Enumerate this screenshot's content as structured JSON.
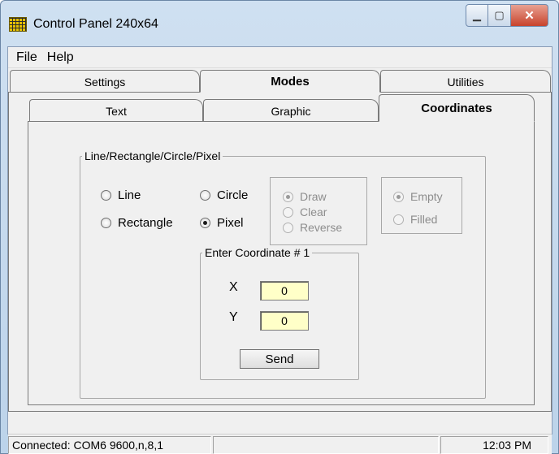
{
  "window": {
    "title": "Control Panel 240x64",
    "icon": "lcd-grid-icon"
  },
  "menu": [
    "File",
    "Help"
  ],
  "outer_tabs": [
    {
      "label": "Settings",
      "active": false
    },
    {
      "label": "Modes",
      "active": true
    },
    {
      "label": "Utilities",
      "active": false
    }
  ],
  "inner_tabs": [
    {
      "label": "Text",
      "active": false
    },
    {
      "label": "Graphic",
      "active": false
    },
    {
      "label": "Coordinates",
      "active": true
    }
  ],
  "shape_group": {
    "legend": "Line/Rectangle/Circle/Pixel",
    "options": [
      {
        "label": "Line",
        "checked": false
      },
      {
        "label": "Circle",
        "checked": false
      },
      {
        "label": "Rectangle",
        "checked": false
      },
      {
        "label": "Pixel",
        "checked": true
      }
    ]
  },
  "draw_mode": {
    "options": [
      {
        "label": "Draw",
        "checked": true,
        "disabled": true
      },
      {
        "label": "Clear",
        "checked": false,
        "disabled": true
      },
      {
        "label": "Reverse",
        "checked": false,
        "disabled": true
      }
    ]
  },
  "fill_mode": {
    "options": [
      {
        "label": "Empty",
        "checked": true,
        "disabled": true
      },
      {
        "label": "Filled",
        "checked": false,
        "disabled": true
      }
    ]
  },
  "coordinate": {
    "legend": "Enter Coordinate # 1",
    "x_label": "X",
    "x_value": "0",
    "y_label": "Y",
    "y_value": "0",
    "send_label": "Send"
  },
  "status": {
    "connection": "Connected: COM6 9600,n,8,1",
    "middle": "",
    "time": "12:03 PM"
  }
}
